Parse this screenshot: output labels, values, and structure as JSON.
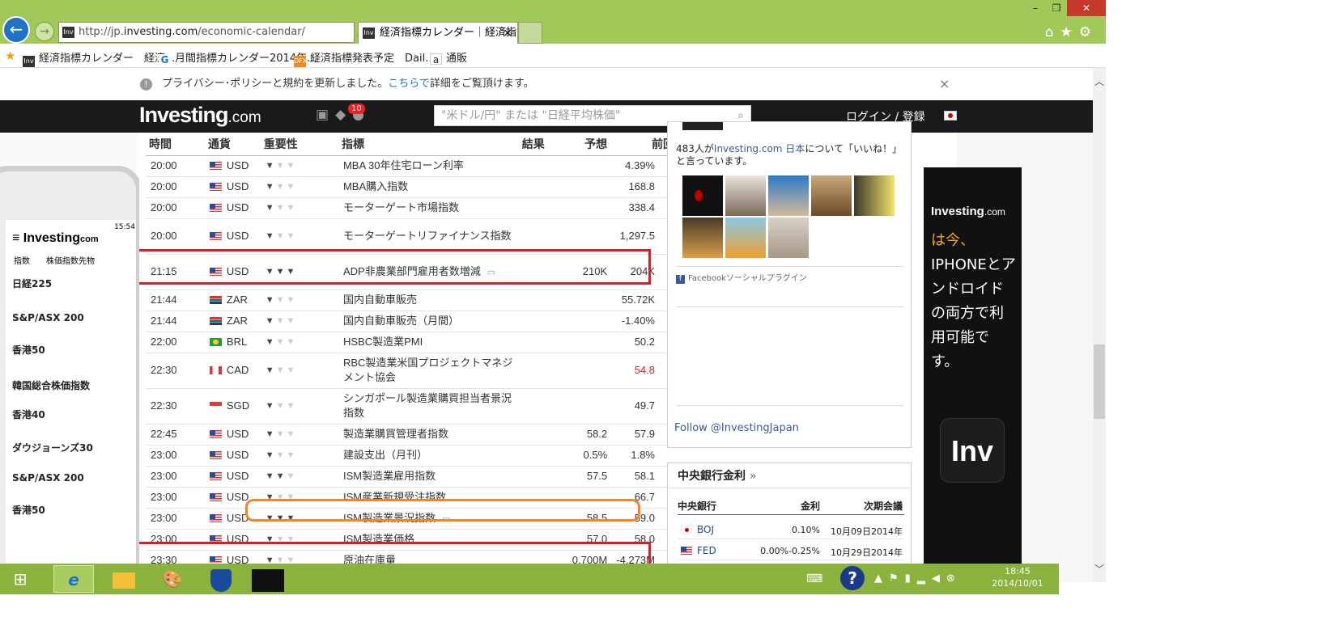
{
  "browser": {
    "url_prefix": "http://jp.",
    "url_domain": "investing.com",
    "url_path": "/economic-calendar/",
    "tab_title": "経済指標カレンダー｜経済指...",
    "tab_close": "×",
    "favicon": "Inv",
    "favorites": [
      {
        "label": "経済指標カレンダー　経済...",
        "icon": "Inv"
      },
      {
        "label": "月間指標カレンダー2014年...",
        "icon": "G"
      },
      {
        "label": "経済指標発表予定　Dail...",
        "icon": "DFX"
      },
      {
        "label": "通販",
        "icon": "a"
      }
    ],
    "window_controls": {
      "minimize": "–",
      "restore": "❐",
      "close": "✕"
    }
  },
  "notice": {
    "text_before": "プライバシー･ポリシーと規約を更新しました。",
    "link": "こちらで",
    "text_after": "詳細をご覧頂けます。",
    "close": "×"
  },
  "site": {
    "logo_main": "Investing",
    "logo_suffix": ".com",
    "notif_count": "10",
    "search_placeholder": "\"米ドル/円\" または \"日経平均株価\"",
    "login": "ログイン / 登録"
  },
  "calendar": {
    "headers": [
      "時間",
      "通貨",
      "重要性",
      "指標",
      "結果",
      "予想",
      "前回"
    ],
    "rows": [
      {
        "time": "20:00",
        "flag": "us",
        "currency": "USD",
        "importance": 1,
        "event": "MBA 30年住宅ローン利率",
        "actual": "",
        "forecast": "",
        "previous": "4.39%",
        "prev_red": false,
        "comment": false
      },
      {
        "time": "20:00",
        "flag": "us",
        "currency": "USD",
        "importance": 1,
        "event": "MBA購入指数",
        "actual": "",
        "forecast": "",
        "previous": "168.8",
        "prev_red": false,
        "comment": false
      },
      {
        "time": "20:00",
        "flag": "us",
        "currency": "USD",
        "importance": 1,
        "event": "モーターゲート市場指数",
        "actual": "",
        "forecast": "",
        "previous": "338.4",
        "prev_red": false,
        "comment": false
      },
      {
        "time": "20:00",
        "flag": "us",
        "currency": "USD",
        "importance": 1,
        "event": "モーターゲートリファイナンス指数",
        "actual": "",
        "forecast": "",
        "previous": "1,297.5",
        "prev_red": false,
        "comment": false
      },
      {
        "time": "21:15",
        "flag": "us",
        "currency": "USD",
        "importance": 3,
        "event": "ADP非農業部門雇用者数増減",
        "actual": "",
        "forecast": "210K",
        "previous": "204K",
        "prev_red": false,
        "comment": true
      },
      {
        "time": "21:44",
        "flag": "za",
        "currency": "ZAR",
        "importance": 1,
        "event": "国内自動車販売",
        "actual": "",
        "forecast": "",
        "previous": "55.72K",
        "prev_red": false,
        "comment": false
      },
      {
        "time": "21:44",
        "flag": "za",
        "currency": "ZAR",
        "importance": 1,
        "event": "国内自動車販売（月間）",
        "actual": "",
        "forecast": "",
        "previous": "-1.40%",
        "prev_red": false,
        "comment": false
      },
      {
        "time": "22:00",
        "flag": "br",
        "currency": "BRL",
        "importance": 1,
        "event": "HSBC製造業PMI",
        "actual": "",
        "forecast": "",
        "previous": "50.2",
        "prev_red": false,
        "comment": false
      },
      {
        "time": "22:30",
        "flag": "ca",
        "currency": "CAD",
        "importance": 1,
        "event": "RBC製造業米国プロジェクトマネジメント協会",
        "actual": "",
        "forecast": "",
        "previous": "54.8",
        "prev_red": true,
        "comment": false
      },
      {
        "time": "22:30",
        "flag": "sg",
        "currency": "SGD",
        "importance": 1,
        "event": "シンガポール製造業購買担当者景況指数",
        "actual": "",
        "forecast": "",
        "previous": "49.7",
        "prev_red": false,
        "comment": false
      },
      {
        "time": "22:45",
        "flag": "us",
        "currency": "USD",
        "importance": 1,
        "event": "製造業購買管理者指数",
        "actual": "",
        "forecast": "58.2",
        "previous": "57.9",
        "prev_red": false,
        "comment": false
      },
      {
        "time": "23:00",
        "flag": "us",
        "currency": "USD",
        "importance": 1,
        "event": "建設支出（月刊）",
        "actual": "",
        "forecast": "0.5%",
        "previous": "1.8%",
        "prev_red": false,
        "comment": false
      },
      {
        "time": "23:00",
        "flag": "us",
        "currency": "USD",
        "importance": 2,
        "event": "ISM製造業雇用指数",
        "actual": "",
        "forecast": "57.5",
        "previous": "58.1",
        "prev_red": false,
        "comment": false
      },
      {
        "time": "23:00",
        "flag": "us",
        "currency": "USD",
        "importance": 1,
        "event": "ISM産業新規受注指数",
        "actual": "",
        "forecast": "",
        "previous": "66.7",
        "prev_red": false,
        "comment": false
      },
      {
        "time": "23:00",
        "flag": "us",
        "currency": "USD",
        "importance": 3,
        "event": "ISM製造業景況指数",
        "actual": "",
        "forecast": "58.5",
        "previous": "59.0",
        "prev_red": false,
        "comment": true
      },
      {
        "time": "23:00",
        "flag": "us",
        "currency": "USD",
        "importance": 1,
        "event": "ISM製造業価格",
        "actual": "",
        "forecast": "57.0",
        "previous": "58.0",
        "prev_red": false,
        "comment": false
      },
      {
        "time": "23:30",
        "flag": "us",
        "currency": "USD",
        "importance": 1,
        "event": "原油在庫量",
        "actual": "",
        "forecast": "0.700M",
        "previous": "-4.273M",
        "prev_red": false,
        "comment": false
      }
    ]
  },
  "facebook": {
    "count_text": "483人が",
    "page_name": "Investing.com 日本",
    "tail": "について「いいね！」と言っています。",
    "plugin": "Facebookソーシャルプラグイン",
    "follow": "Follow @InvestingJapan"
  },
  "central_bank": {
    "title": "中央銀行金利",
    "title_arrow": "»",
    "headers": {
      "bank": "中央銀行",
      "rate": "金利",
      "next": "次期会議"
    },
    "rows": [
      {
        "bank": "BOJ",
        "rate": "0.10%",
        "next": "10月09日2014年"
      },
      {
        "bank": "FED",
        "rate": "0.00%-0.25%",
        "next": "10月29日2014年"
      }
    ]
  },
  "ad": {
    "logo_main": "Investing",
    "logo_suffix": ".com",
    "line1": "は今、",
    "line2": "IPHONEとアンドロイドの両方で利用可能です。",
    "app_icon": "Inv"
  },
  "phone": {
    "time": "15:54",
    "brand": "Investing",
    "brand_suffix": "com",
    "tabs": [
      "指数",
      "株価指数先物"
    ],
    "items": [
      "日経225",
      "S&P/ASX 200",
      "香港50",
      "韓国総合株価指数",
      "香港40",
      "ダウジョーンズ30",
      "S&P/ASX 200",
      "香港50"
    ]
  },
  "taskbar": {
    "clock_time": "18:45",
    "clock_date": "2014/10/01"
  }
}
